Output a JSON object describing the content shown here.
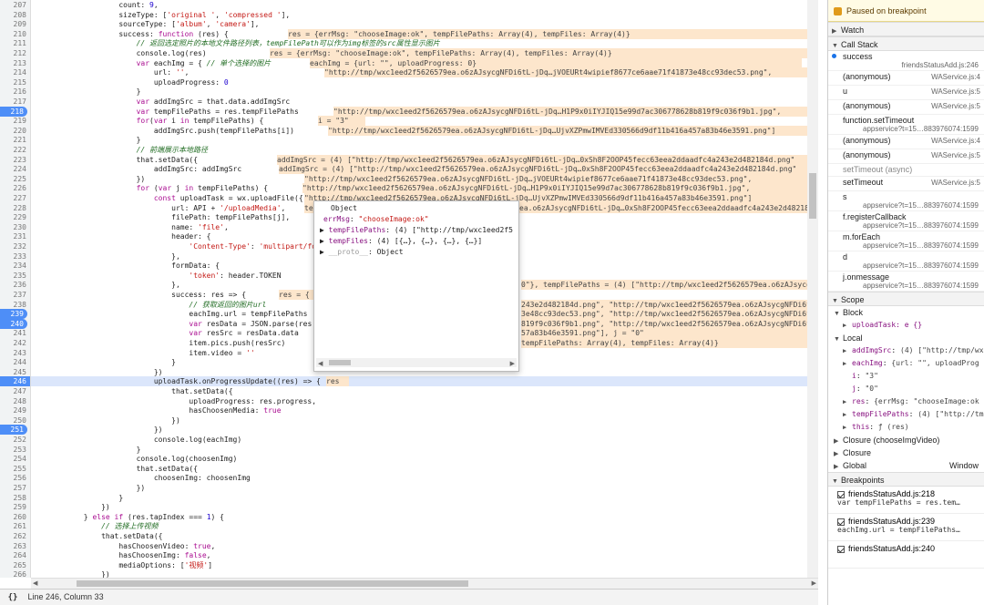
{
  "lines": [
    {
      "n": "207",
      "t": "                    count: 9,"
    },
    {
      "n": "208",
      "t": "                    sizeType: ['original ', 'compressed '],"
    },
    {
      "n": "209",
      "t": "                    sourceType: ['album', 'camera'],"
    },
    {
      "n": "210",
      "t": "                    success: function (res) {"
    },
    {
      "n": "211",
      "t": "                        // 返回选定照片的本地文件路径列表，tempFilePath可以作为img标签的src属性显示图片"
    },
    {
      "n": "212",
      "t": "                        console.log(res)"
    },
    {
      "n": "213",
      "t": "                        var eachImg = { // 单个选择的图片"
    },
    {
      "n": "214",
      "t": "                            url: '',"
    },
    {
      "n": "215",
      "t": "                            uploadProgress: 0"
    },
    {
      "n": "216",
      "t": "                        }"
    },
    {
      "n": "217",
      "t": "                        var addImgSrc = that.data.addImgSrc"
    },
    {
      "n": "218",
      "t": "                        var tempFilePaths = res.tempFilePaths"
    },
    {
      "n": "219",
      "t": "                        for(var i in tempFilePaths) {"
    },
    {
      "n": "220",
      "t": "                            addImgSrc.push(tempFilePaths[i])"
    },
    {
      "n": "221",
      "t": "                        }"
    },
    {
      "n": "222",
      "t": "                        // 前端展示本地路径"
    },
    {
      "n": "223",
      "t": "                        that.setData({"
    },
    {
      "n": "224",
      "t": "                            addImgSrc: addImgSrc"
    },
    {
      "n": "225",
      "t": "                        })"
    },
    {
      "n": "226",
      "t": "                        for (var j in tempFilePaths) {"
    },
    {
      "n": "227",
      "t": "                            const uploadTask = wx.uploadFile({"
    },
    {
      "n": "228",
      "t": "                                url: API + '/uploadMedia',"
    },
    {
      "n": "229",
      "t": "                                filePath: tempFilePaths[j],"
    },
    {
      "n": "230",
      "t": "                                name: 'file',"
    },
    {
      "n": "231",
      "t": "                                header: {"
    },
    {
      "n": "232",
      "t": "                                    'Content-Type': 'multipart/form-data'"
    },
    {
      "n": "233",
      "t": "                                },"
    },
    {
      "n": "234",
      "t": "                                formData: {"
    },
    {
      "n": "235",
      "t": "                                    'token': header.TOKEN"
    },
    {
      "n": "236",
      "t": "                                },"
    },
    {
      "n": "237",
      "t": "                                success: res => {"
    },
    {
      "n": "238",
      "t": "                                    // 获取返回的图片url"
    },
    {
      "n": "239",
      "t": "                                    eachImg.url = tempFilePaths"
    },
    {
      "n": "240",
      "t": "                                    var resData = JSON.parse(res.data)"
    },
    {
      "n": "241",
      "t": "                                    var resSrc = resData.data"
    },
    {
      "n": "242",
      "t": "                                    item.pics.push(resSrc)"
    },
    {
      "n": "243",
      "t": "                                    item.video = ''"
    },
    {
      "n": "244",
      "t": "                                }"
    },
    {
      "n": "245",
      "t": "                            })"
    },
    {
      "n": "246",
      "t": "                            uploadTask.onProgressUpdate((res) => {"
    },
    {
      "n": "247",
      "t": "                                that.setData({"
    },
    {
      "n": "248",
      "t": "                                    uploadProgress: res.progress,"
    },
    {
      "n": "249",
      "t": "                                    hasChoosenMedia: true"
    },
    {
      "n": "250",
      "t": "                                })"
    },
    {
      "n": "251",
      "t": "                            })"
    },
    {
      "n": "252",
      "t": "                            console.log(eachImg)"
    },
    {
      "n": "253",
      "t": "                        }"
    },
    {
      "n": "254",
      "t": "                        console.log(choosenImg)"
    },
    {
      "n": "255",
      "t": "                        that.setData({"
    },
    {
      "n": "256",
      "t": "                            choosenImg: choosenImg"
    },
    {
      "n": "257",
      "t": "                        })"
    },
    {
      "n": "258",
      "t": "                    }"
    },
    {
      "n": "259",
      "t": "                })"
    },
    {
      "n": "260",
      "t": "            } else if (res.tapIndex === 1) {"
    },
    {
      "n": "261",
      "t": "                // 选择上传视频"
    },
    {
      "n": "262",
      "t": "                that.setData({"
    },
    {
      "n": "263",
      "t": "                    hasChoosenVideo: true,"
    },
    {
      "n": "264",
      "t": "                    hasChoosenImg: false,"
    },
    {
      "n": "265",
      "t": "                    mediaOptions: ['视频']"
    },
    {
      "n": "266",
      "t": "                })"
    }
  ],
  "inline_values": [
    "res = {errMsg: \"chooseImage:ok\", tempFilePaths: Array(4), tempFiles: Array(4)}",
    "res = {errMsg: \"chooseImage:ok\", tempFilePaths: Array(4), tempFiles: Array(4)}",
    "eachImg = {url: \"\", uploadProgress: 0}",
    "addImgSrc = (4) [\"http://tmp/wxc1eed2f5626579ea.o6zAJsycgNFDi6tL-jDq…0xSh8F2OOP45fecc63eea2ddaadfc4a243e2d482184d.png\"",
    "tempFilePaths = (4) [\"http://tmp/wxc1eed2f5626579ea.o6zAJsycgNFDi6tL-jDq…0xSh8F2OOP45fecc63eea2ddaadfc4a243e2d482184d.png\",",
    "i = \"3\"",
    "addImgSrc = (4) [\"http://tmp/wxc1eed2f5626579ea.o6zAJsycgNFDi6tL-jDq…0xSh8F2OOP45fecc63eea2ddaadfc4a243e2d482184d.png\"",
    "j = \"0\", tempFilePaths = (4) [\"http://tmp/wxc1eed2f5626579ea.o6zAJsycgNFDi6tL-jDq…0xSh8F2OOP45fecc63eea2ddaadfc4a",
    "tempFilePaths = (4) [\"http://tmp/wxc1eed2f5626579ea.o6zAJsycgNFDi6tL-jDq…0xSh8F2OOP45fecc63eea2ddaadfc4a243",
    "\"http://tmp/wxc1eed2f5626579ea.o6zAJsycgNFDi6tL-jDq…jVOEURt4wipief8677ce6aae71f41873e48cc93dec53.png\", \"http://tmp/wxc1eed2f5626579ea.o6zAJsycgNFDi6tL-jDq…H1P9x0iIYJIQ15e99d7ac306778628b819f9c036f9b1.jpg\", \"http://tmp/wxc1eed2f5626579ea.o6zAJsycgNFDi6tL-jDq…UjvXZPmwIMVEd330566d9df11b416a457a83b46e3591.png\"], j = \"0\"",
    "\"http://tmp/wxc1eed2f5626579ea.o6zAJsycgNFDi6tL-jDq…jVOEURt4wipief8677ce6aae71f41873e48cc93dec53.png\",",
    "\"http://tmp/wxc1eed2f5626579ea.o6zAJsycgNFDi6tL-jDq…H1P9x0iIYJIQ15e99d7ac306778628b819f9c036f9b1.jpg\",",
    "\"http://tmp/wxc1eed2f5626579ea.o6zAJsycgNFDi6tL-jDq…UjvXZPmwIMVEd330566d9df11b416a457a83b46e3591.png\"]",
    "0\"}, tempFilePaths = (4) [\"http://tmp/wxc1eed2f5626579ea.o6zAJsycgNFDi6tL-jDq…0xSh8F2OOP45fecc63eea2ddaadfc4a243e2d482184d.png\", \"http://tmp/wxc1eed2f5626579ea.o6zAJsycgNFDi6tL-jDq…",
    "res = {",
    "243e2d482184d.png\", \"http://tmp/wxc1eed2f5626579ea.o6zAJsycgNFDi6tL-jDq…",
    "3e48cc93dec53.png\", \"http://tmp/wxc1eed2f5626579ea.o6zAJsycgNFDi6tL-jDq…",
    "819f9c036f9b1.png\", \"http://tmp/wxc1eed2f5626579ea.o6zAJsycgNFDi6tL-jDq…",
    "57a83b46e3591.png\"], j = \"0\"",
    "tempFilePaths: Array(4), tempFiles: Array(4)}",
    "res"
  ],
  "popover": {
    "title": "Object",
    "err_key": "errMsg",
    "err_val": "\"chooseImage:ok\"",
    "paths_key": "tempFilePaths",
    "paths_val": "(4) [\"http://tmp/wxc1eed2f5",
    "files_key": "tempFiles",
    "files_val": "(4) [{…}, {…}, {…}, {…}]",
    "proto_key": "__proto__",
    "proto_val": "Object"
  },
  "status": {
    "brace": "{}",
    "position": "Line 246, Column 33"
  },
  "debugger": {
    "paused": "Paused on breakpoint",
    "watch": "Watch",
    "call_stack": "Call Stack",
    "frames": [
      {
        "name": "success",
        "loc": "friendsStatusAdd.js:246"
      },
      {
        "name": "(anonymous)",
        "loc": "WAService.js:4"
      },
      {
        "name": "u",
        "loc": "WAService.js:5"
      },
      {
        "name": "(anonymous)",
        "loc": "WAService.js:5"
      },
      {
        "name": "function.setTimeout",
        "loc": "appservice?t=15…883976074:1599"
      },
      {
        "name": "(anonymous)",
        "loc": "WAService.js:4"
      },
      {
        "name": "(anonymous)",
        "loc": "WAService.js:5"
      }
    ],
    "async_label": "setTimeout (async)",
    "frames2": [
      {
        "name": "setTimeout",
        "loc": "WAService.js:5"
      },
      {
        "name": "s",
        "loc": "appservice?t=15…883976074:1599"
      },
      {
        "name": "f.registerCallback",
        "loc": "appservice?t=15…883976074:1599"
      },
      {
        "name": "m.forEach",
        "loc": "appservice?t=15…883976074:1599"
      },
      {
        "name": "d",
        "loc": "appservice?t=15…883976074:1599"
      },
      {
        "name": "j.onmessage",
        "loc": "appservice?t=15…883976074:1599"
      }
    ],
    "scope": "Scope",
    "block": "Block",
    "block_item": "uploadTask: e {}",
    "local": "Local",
    "local_items": [
      "addImgSrc: (4) [\"http://tmp/wxc",
      "eachImg: {url: \"\", uploadProg",
      "i: \"3\"",
      "j: \"0\"",
      "res: {errMsg: \"chooseImage:ok",
      "tempFilePaths: (4) [\"http://tmp",
      "this: ƒ (res)"
    ],
    "closure1": "Closure (chooseImgVideo)",
    "closure2": "Closure",
    "global": "Global",
    "global_val": "Window",
    "breakpoints": "Breakpoints",
    "bps": [
      {
        "file": "friendsStatusAdd.js:218",
        "code": "var tempFilePaths = res.tem…"
      },
      {
        "file": "friendsStatusAdd.js:239",
        "code": "eachImg.url = tempFilePaths…"
      },
      {
        "file": "friendsStatusAdd.js:240",
        "code": ""
      }
    ]
  }
}
